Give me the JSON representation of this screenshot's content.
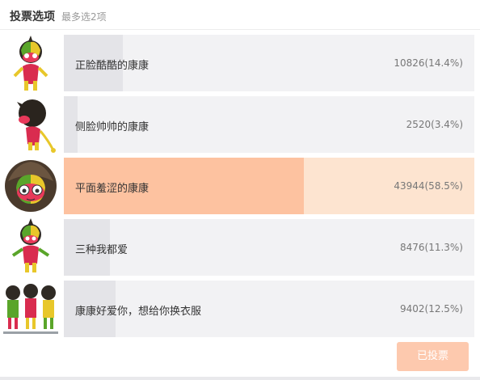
{
  "poll": {
    "title": "投票选项",
    "subtitle": "最多选2项",
    "options": [
      {
        "label": "正脸酷酷的康康",
        "count": "10826(14.4%)",
        "percent": 14.4,
        "selected": false,
        "image": "kangkang-front-mascot"
      },
      {
        "label": "侧脸帅帅的康康",
        "count": "2520(3.4%)",
        "percent": 3.4,
        "selected": false,
        "image": "kangkang-side-mascot"
      },
      {
        "label": "平面羞涩的康康",
        "count": "43944(58.5%)",
        "percent": 58.5,
        "selected": true,
        "image": "kangkang-flat-face"
      },
      {
        "label": "三种我都爱",
        "count": "8476(11.3%)",
        "percent": 11.3,
        "selected": false,
        "image": "kangkang-front-mascot"
      },
      {
        "label": "康康好爱你，想给你换衣服",
        "count": "9402(12.5%)",
        "percent": 12.5,
        "selected": false,
        "image": "kangkang-outfits"
      }
    ],
    "voted_label": "已投票"
  },
  "colors": {
    "bar_bg": "#f2f2f4",
    "bar_fill": "#e4e4e8",
    "selected_bg": "#fde4d0",
    "selected_fill": "#fdc2a0",
    "button_bg": "#fdc9ae"
  }
}
